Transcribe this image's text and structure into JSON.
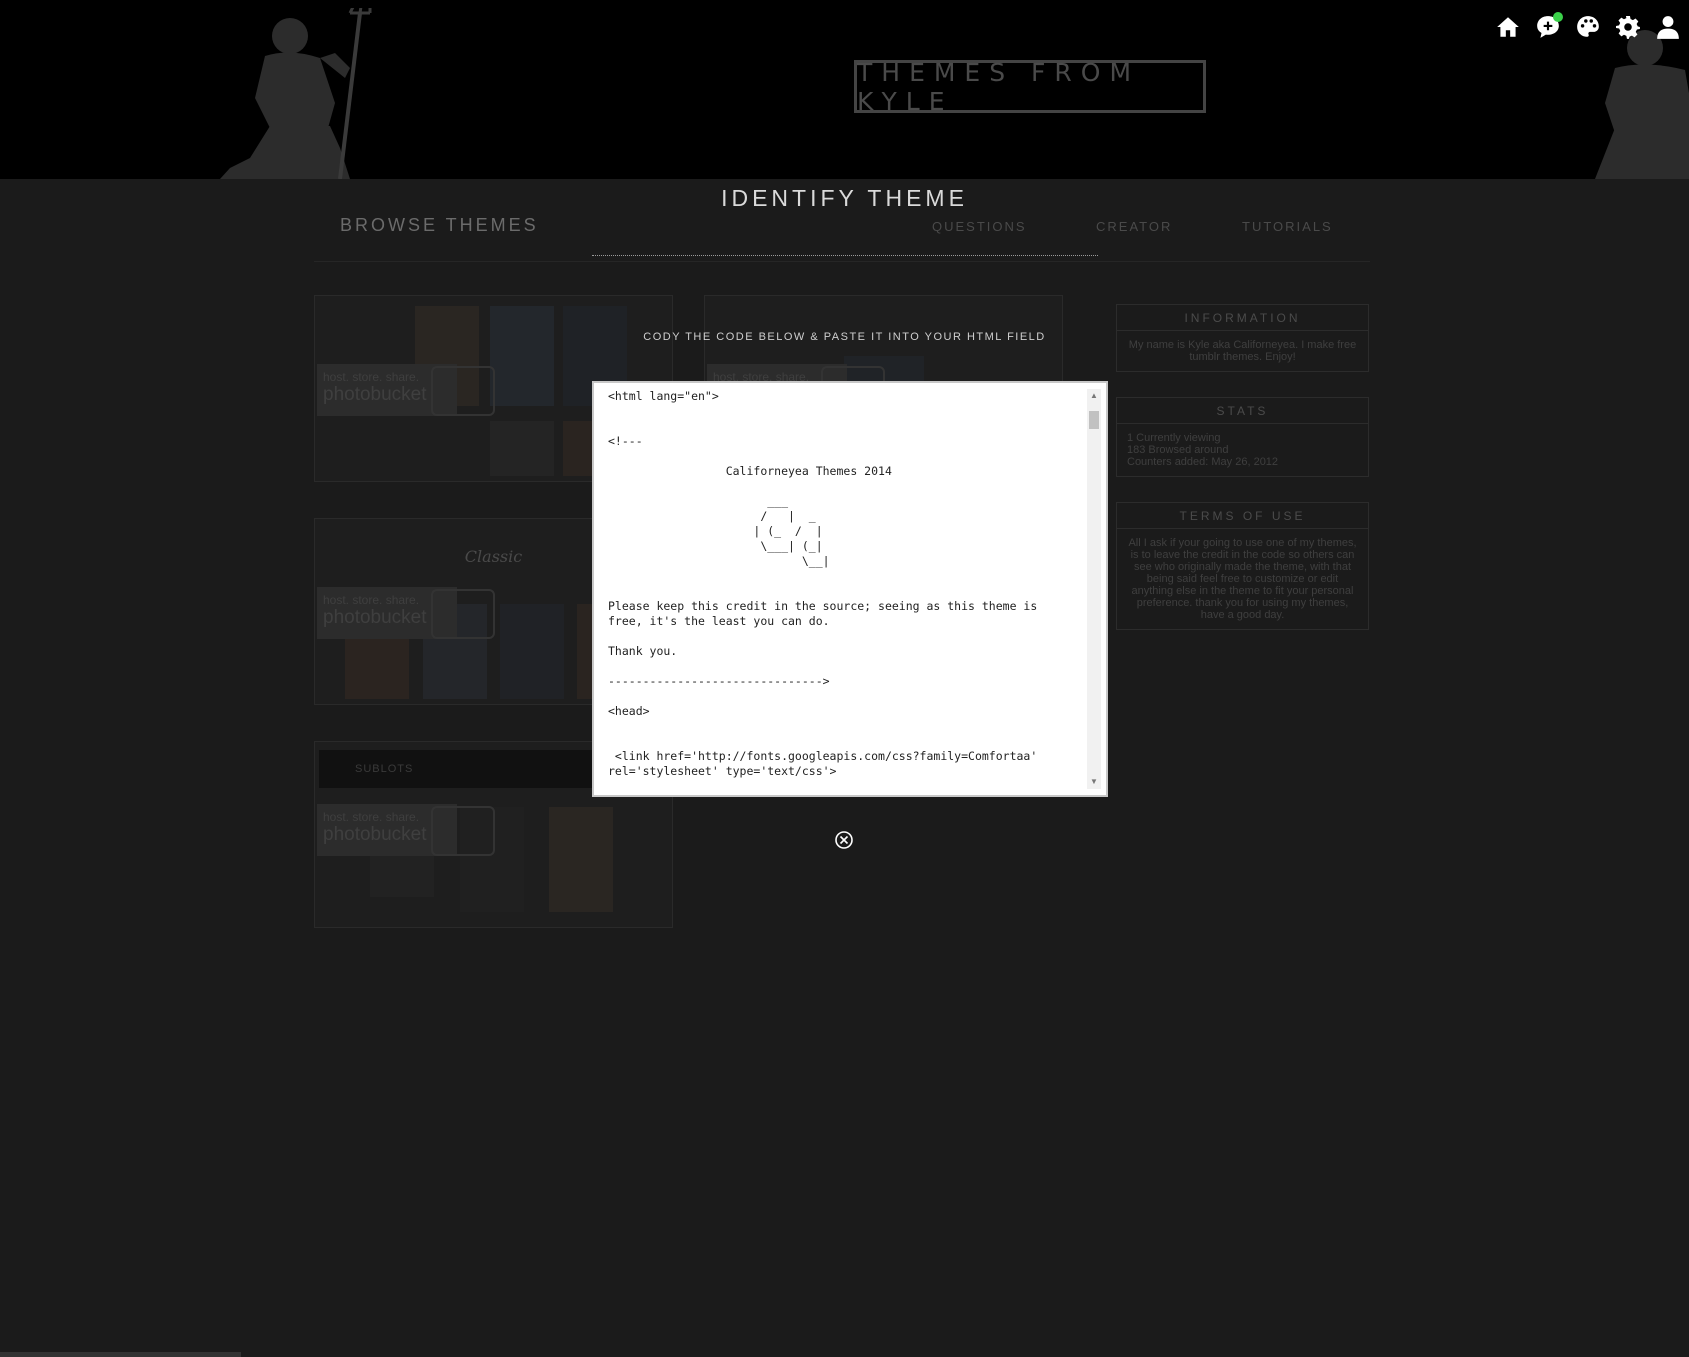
{
  "header": {
    "site_title": "THEMES FROM KYLE",
    "icons": [
      "home-icon",
      "chat-plus-icon",
      "palette-icon",
      "gear-icon",
      "user-icon"
    ],
    "notification_color": "#3bd14a"
  },
  "nav": {
    "browse": "BROWSE THEMES",
    "links": [
      "QUESTIONS",
      "CREATOR",
      "TUTORIALS"
    ]
  },
  "gallery": {
    "photobucket_small": "host. store. share.",
    "photobucket_big": "photobucket",
    "tile_titles": [
      "Classic",
      "SUBLOTS"
    ]
  },
  "sidebar": {
    "information": {
      "title": "INFORMATION",
      "body": "My name is Kyle aka Californeyea. I make free tumblr themes. Enjoy!"
    },
    "stats": {
      "title": "STATS",
      "lines": [
        "1 Currently viewing",
        "183 Browsed around",
        "Counters added: May 26, 2012"
      ]
    },
    "terms": {
      "title": "TERMS OF USE",
      "body": "All I ask if your going to use one of my themes, is to leave the credit in the code so others can see who originally made the theme, with that being said feel free to customize or edit anything else in the theme to fit your personal preference. thank you for using my themes, have a good day."
    }
  },
  "modal": {
    "title": "IDENTIFY THEME",
    "instruction": "CODY THE CODE BELOW & PASTE IT INTO YOUR HTML FIELD",
    "code": "<html lang=\"en\">\n\n\n<!---\n\n                 Californeyea Themes 2014\n\n                       ___\n                      /   |  _\n                     | (_  /  |\n                      \\___| (_|\n                            \\__|\n\n\nPlease keep this credit in the source; seeing as this theme is\nfree, it's the least you can do.\n\nThank you.\n\n------------------------------->\n\n<head>\n\n\n <link href='http://fonts.googleapis.com/css?family=Comfortaa'\nrel='stylesheet' type='text/css'>",
    "close_icon": "close-circle-icon"
  }
}
